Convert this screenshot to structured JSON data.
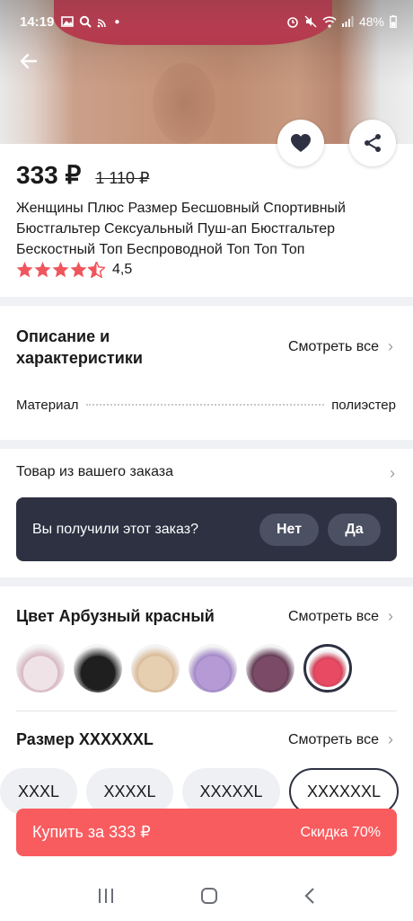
{
  "status_bar": {
    "time": "14:19",
    "battery": "48%"
  },
  "product": {
    "price": "333 ₽",
    "old_price": "1 110 ₽",
    "title": "Женщины Плюс Размер Бесшовный Спортивный Бюстгальтер Сексуальный Пуш-ап Бюстгальтер Бескостный Топ Беспроводной Топ Топ Топ",
    "rating": "4,5"
  },
  "description": {
    "title": "Описание и характеристики",
    "see_all": "Смотреть все",
    "spec_name": "Материал",
    "spec_value": "полиэстер"
  },
  "order": {
    "label": "Товар из вашего заказа",
    "question": "Вы получили этот заказ?",
    "no": "Нет",
    "yes": "Да"
  },
  "color": {
    "title": "Цвет Арбузный красный",
    "see_all": "Смотреть все",
    "swatches": [
      {
        "color": "#efe3e8",
        "accent": "#d6b6c2"
      },
      {
        "color": "#1f1f1f",
        "accent": "#3a3a3a"
      },
      {
        "color": "#e6cfb0",
        "accent": "#d8b894"
      },
      {
        "color": "#b59ad6",
        "accent": "#9f84c5"
      },
      {
        "color": "#7a4a66",
        "accent": "#5e3650"
      },
      {
        "color": "#e84a63",
        "accent": "#d03a52"
      }
    ]
  },
  "size": {
    "title": "Размер XXXXXXL",
    "see_all": "Смотреть все",
    "options": [
      "XXXL",
      "XXXXL",
      "XXXXXL",
      "XXXXXXL"
    ]
  },
  "buy": {
    "label": "Купить за 333 ₽",
    "discount": "Скидка 70%"
  },
  "colors": {
    "accent": "#f85c5f",
    "dark": "#2d3142",
    "star": "#f0555c"
  }
}
